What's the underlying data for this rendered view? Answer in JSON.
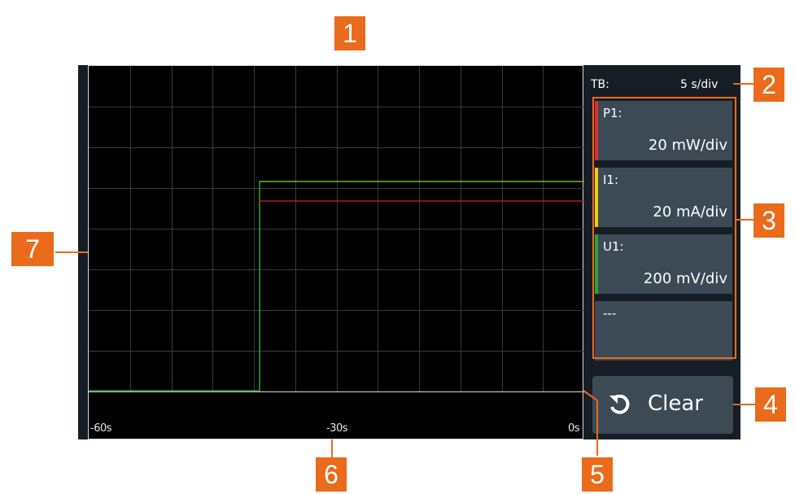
{
  "plot": {
    "x_labels": [
      "-60s",
      "-30s",
      "0s"
    ],
    "grid_lines": {
      "vertical": 12,
      "horizontal": 8
    },
    "colors": {
      "grid": "#3a3a3a",
      "P1": "#cc2222",
      "I1": "#e6d21c",
      "U1": "#2fa52f",
      "border": "#d9d9d9"
    }
  },
  "timebase": {
    "label": "TB:",
    "value": "5 s/div"
  },
  "channels": [
    {
      "name": "P1:",
      "scale": "20 mW/div",
      "color": "#e03030"
    },
    {
      "name": "I1:",
      "scale": "20 mA/div",
      "color": "#f0d000"
    },
    {
      "name": "U1:",
      "scale": "200 mV/div",
      "color": "#2fa52f"
    },
    {
      "name": "---",
      "scale": "",
      "color": ""
    }
  ],
  "clear_button": {
    "label": "Clear",
    "icon": "undo-icon"
  },
  "callouts": [
    "1",
    "2",
    "3",
    "4",
    "5",
    "6",
    "7"
  ],
  "accent_color": "#ea6b1b"
}
